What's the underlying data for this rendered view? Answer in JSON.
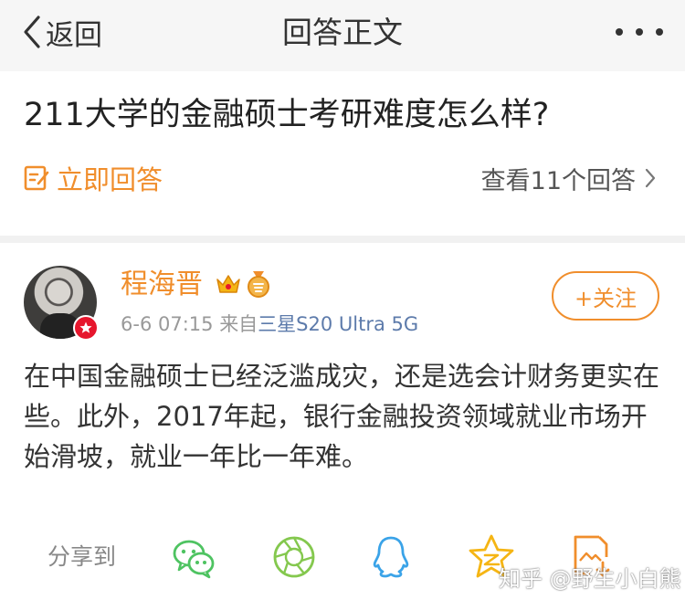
{
  "navbar": {
    "back_label": "返回",
    "title": "回答正文"
  },
  "question": {
    "title": "211大学的金融硕士考研难度怎么样?",
    "answer_label": "立即回答",
    "view_answers_label": "查看11个回答"
  },
  "answer": {
    "author": "程海晋",
    "date": "6-6 07:15",
    "source_prefix": "来自",
    "source": "三星S20 Ultra 5G",
    "follow_label": "+关注",
    "content": "在中国金融硕士已经泛滥成灾，还是选会计财务更实在些。此外，2017年起，银行金融投资领域就业市场开始滑坡，就业一年比一年难。"
  },
  "share": {
    "label": "分享到",
    "targets": [
      "wechat-icon",
      "moments-icon",
      "qq-icon",
      "qzone-icon",
      "save-image-icon"
    ]
  },
  "watermark": "知乎 @野生小白熊",
  "colors": {
    "accent": "#f08e2c",
    "wechat": "#4ec361",
    "moments": "#84c84e",
    "qq": "#3aa3e8",
    "qzone": "#f5b514",
    "save": "#f08e2c",
    "verified": "#e6162d"
  }
}
